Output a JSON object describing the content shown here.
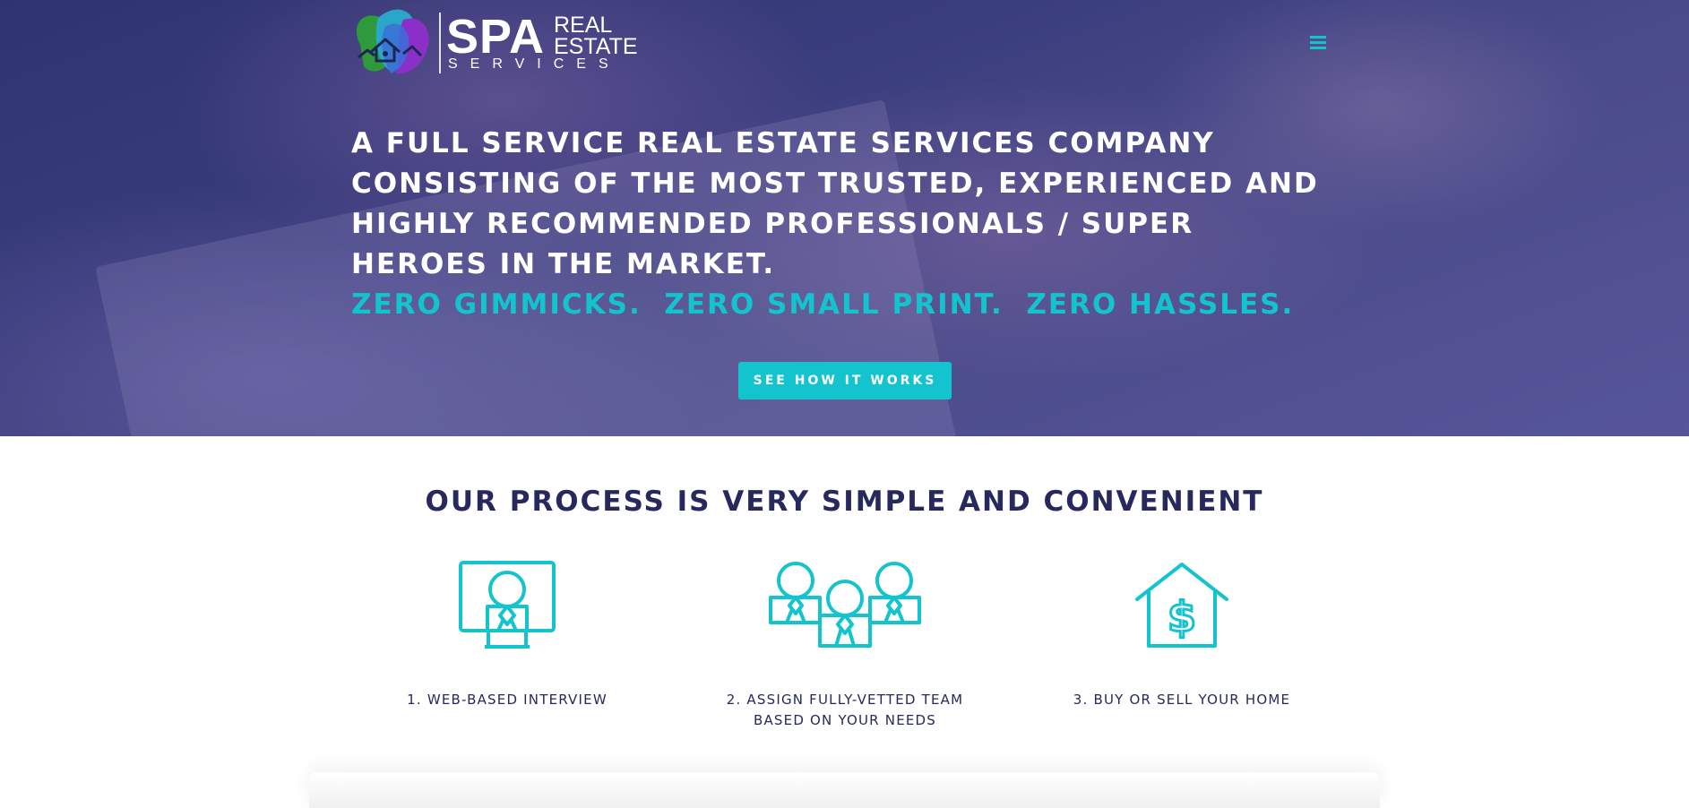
{
  "brand": {
    "name_large": "SPA",
    "name_line1": "REAL",
    "name_line2": "ESTATE",
    "name_line3": "SERVICES"
  },
  "nav": {
    "menu_icon": "hamburger-menu-icon"
  },
  "hero": {
    "headline": "A FULL SERVICE REAL ESTATE SERVICES COMPANY CONSISTING OF THE MOST TRUSTED,  EXPERIENCED AND HIGHLY RECOMMENDED PROFESSIONALS / SUPER HEROES IN THE MARKET.",
    "tagline": "ZERO GIMMICKS.  ZERO SMALL PRINT.  ZERO HASSLES.",
    "cta_label": "SEE HOW IT WORKS"
  },
  "process": {
    "title": "OUR PROCESS IS VERY SIMPLE AND CONVENIENT",
    "steps": [
      {
        "icon": "video-interview-icon",
        "label": "1. WEB-BASED INTERVIEW"
      },
      {
        "icon": "team-icon",
        "label": "2. ASSIGN FULLY-VETTED TEAM BASED ON YOUR NEEDS"
      },
      {
        "icon": "house-dollar-icon",
        "label": "3. BUY OR SELL YOUR HOME"
      }
    ]
  },
  "colors": {
    "accent": "#13c4cf",
    "navy": "#27295e",
    "hero_overlay": "#3a3d7d",
    "white": "#ffffff"
  }
}
